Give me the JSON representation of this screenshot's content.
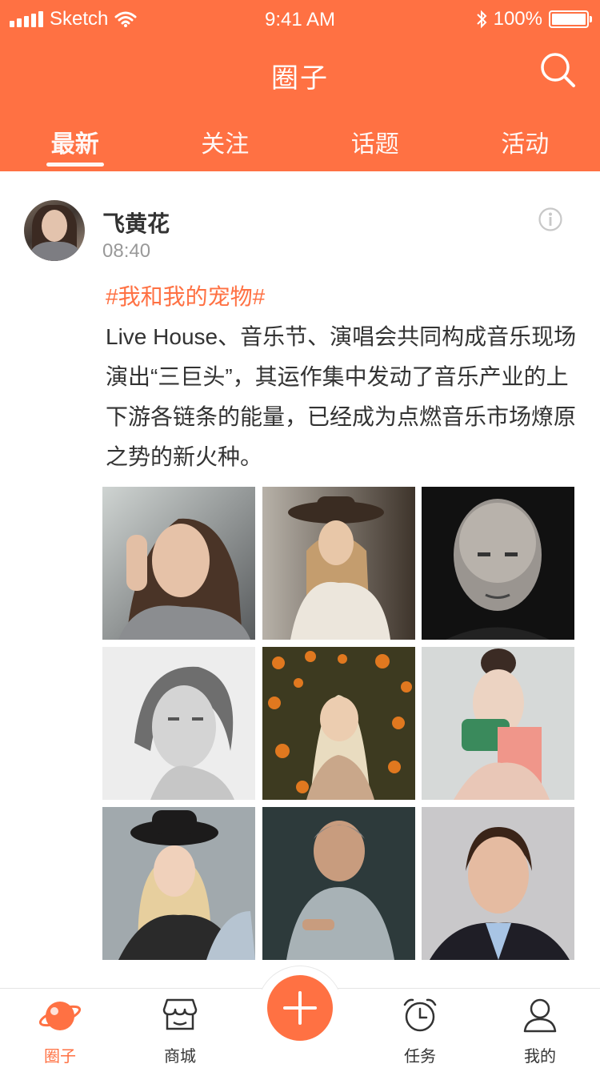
{
  "status_bar": {
    "carrier": "Sketch",
    "time": "9:41 AM",
    "battery": "100%"
  },
  "header": {
    "title": "圈子",
    "tabs": [
      {
        "label": "最新",
        "active": true
      },
      {
        "label": "关注",
        "active": false
      },
      {
        "label": "话题",
        "active": false
      },
      {
        "label": "活动",
        "active": false
      }
    ]
  },
  "post": {
    "username": "飞黄花",
    "time": "08:40",
    "topic": "#我和我的宠物#",
    "text": "Live House、音乐节、演唱会共同构成音乐现场演出“三巨头”，其运作集中发动了音乐产业的上下游各链条的能量，已经成为点燃音乐市场燎原之势的新火种。",
    "photo_count": 9
  },
  "tabbar": {
    "items": [
      {
        "label": "圈子",
        "icon": "planet-icon",
        "active": true
      },
      {
        "label": "商城",
        "icon": "shop-icon",
        "active": false
      },
      {
        "label": "",
        "icon": "plus-icon",
        "active": false
      },
      {
        "label": "任务",
        "icon": "alarm-clock-icon",
        "active": false
      },
      {
        "label": "我的",
        "icon": "user-icon",
        "active": false
      }
    ]
  },
  "colors": {
    "accent": "#FF7143",
    "text": "#333333",
    "muted": "#999999"
  }
}
